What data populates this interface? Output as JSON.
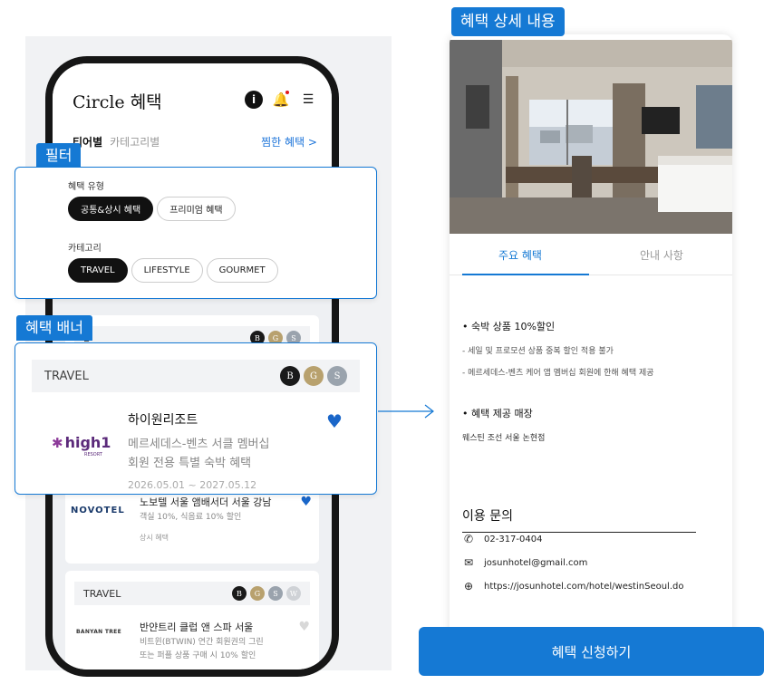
{
  "phone": {
    "app_title": "Circle 혜택",
    "tab_tier": "티어별",
    "tab_category": "카테고리별",
    "fav_link": "찜한 혜택 >"
  },
  "filter": {
    "label": "필터",
    "type_label": "혜택 유형",
    "type_chips": [
      "공통&상시 혜택",
      "프리미엄 혜택"
    ],
    "category_label": "카테고리",
    "category_chips": [
      "TRAVEL",
      "LIFESTYLE",
      "GOURMET"
    ]
  },
  "banner": {
    "label": "혜택 배너",
    "category": "TRAVEL",
    "tiers": [
      "B",
      "G",
      "S"
    ],
    "name": "하이원리조트",
    "desc1": "메르세데스-벤츠 서클 멤버십",
    "desc2": "회원 전용 특별 숙박 혜택",
    "period": "2026.05.01 ~ 2027.05.12",
    "logo_text": "high1",
    "logo_sub": "RESORT"
  },
  "list": {
    "partial_category": "L",
    "novotel": {
      "logo": "NOVOTEL",
      "title": "노보텔 서울 앰배서더 서울 강남",
      "desc": "객실 10%, 식음료 10% 할인",
      "tag": "상시 혜택"
    },
    "banyan": {
      "category": "TRAVEL",
      "tiers": [
        "B",
        "G",
        "S",
        "W"
      ],
      "logo": "BANYAN TREE",
      "title": "반얀트리 클럽 앤 스파 서울",
      "desc1": "비트윈(BTWIN) 연간 회원권의 그린",
      "desc2": "또는 퍼플 상품 구매 시 10% 할인"
    }
  },
  "detail": {
    "label": "혜택 상세 내용",
    "tabs": [
      "주요 혜택",
      "안내 사항"
    ],
    "section1_title": "• 숙박 상품 10%할인",
    "section1_lines": [
      "- 세일 및 프로모션 상품 중복 할인 적용 불가",
      "- 메르세데스-벤츠 케어 앱 멤버십 회원에 한해 혜택 제공"
    ],
    "section2_title": "• 혜택 제공 매장",
    "section2_line": "웨스틴 조선 서울 논현점",
    "contact_title": "이용 문의",
    "phone": "02-317-0404",
    "email": "josunhotel@gmail.com",
    "url": "https://josunhotel.com/hotel/westinSeoul.do",
    "apply_button": "혜택 신청하기"
  },
  "colors": {
    "accent": "#1579d4",
    "black": "#111111",
    "heart": "#1a66c9"
  },
  "icons": [
    "info-icon",
    "bell-icon",
    "menu-icon",
    "heart-icon",
    "phone-icon",
    "mail-icon",
    "globe-icon",
    "arrow-right-icon"
  ]
}
